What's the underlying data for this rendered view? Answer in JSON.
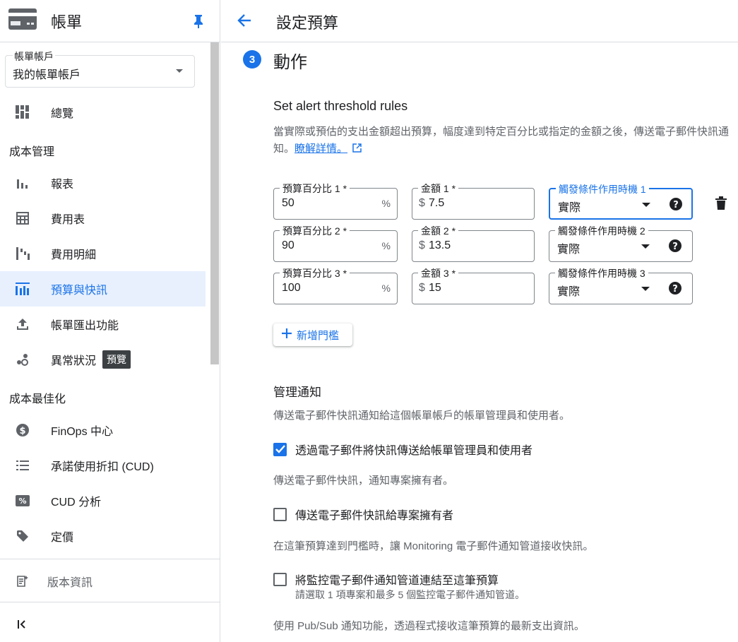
{
  "sidebar": {
    "title": "帳單",
    "account": {
      "label": "帳單帳戶",
      "value": "我的帳單帳戶"
    },
    "items": [
      {
        "label": "總覽"
      },
      {
        "label": "報表"
      },
      {
        "label": "費用表"
      },
      {
        "label": "費用明細"
      },
      {
        "label": "預算與快訊"
      },
      {
        "label": "帳單匯出功能"
      },
      {
        "label": "異常狀況",
        "badge": "預覽"
      },
      {
        "label": "FinOps 中心"
      },
      {
        "label": "承諾使用折扣 (CUD)"
      },
      {
        "label": "CUD 分析"
      },
      {
        "label": "定價"
      }
    ],
    "sections": {
      "cost_management": "成本管理",
      "cost_optimization": "成本最佳化"
    },
    "release_notes": "版本資訊",
    "collapse_icon": "collapse-icon"
  },
  "header": {
    "title": "設定預算"
  },
  "step": {
    "number": "3",
    "title": "動作"
  },
  "threshold": {
    "heading": "Set alert threshold rules",
    "description": "當實際或預估的支出金額超出預算，幅度達到特定百分比或指定的金額之後，傳送電子郵件快訊通知。",
    "learn_more": "瞭解詳情。",
    "currency_symbol": "$",
    "percent_symbol": "%",
    "rows": [
      {
        "pct_label": "預算百分比 1 *",
        "pct": "50",
        "amt_label": "金額 1 *",
        "amt": "7.5",
        "trig_label": "觸發條件作用時機 1",
        "trig": "實際"
      },
      {
        "pct_label": "預算百分比 2 *",
        "pct": "90",
        "amt_label": "金額 2 *",
        "amt": "13.5",
        "trig_label": "觸發條件作用時機 2",
        "trig": "實際"
      },
      {
        "pct_label": "預算百分比 3 *",
        "pct": "100",
        "amt_label": "金額 3 *",
        "amt": "15",
        "trig_label": "觸發條件作用時機 3",
        "trig": "實際"
      }
    ],
    "add_button": "新增門檻"
  },
  "notify": {
    "heading": "管理通知",
    "desc1": "傳送電子郵件快訊通知給這個帳單帳戶的帳單管理員和使用者。",
    "chk1": "透過電子郵件將快訊傳送給帳單管理員和使用者",
    "desc2": "傳送電子郵件快訊，通知專案擁有者。",
    "chk2": "傳送電子郵件快訊給專案擁有者",
    "desc3": "在這筆預算達到門檻時，讓 Monitoring 電子郵件通知管道接收快訊。",
    "chk3": "將監控電子郵件通知管道連結至這筆預算",
    "chk3_sub": "請選取 1 項專案和最多 5 個監控電子郵件通知管道。",
    "desc4": "使用 Pub/Sub 通知功能，透過程式接收這筆預算的最新支出資訊。"
  },
  "colors": {
    "accent": "#1a73e8",
    "active_bg": "#e8f0fe",
    "badge_bg": "#3c4043"
  }
}
